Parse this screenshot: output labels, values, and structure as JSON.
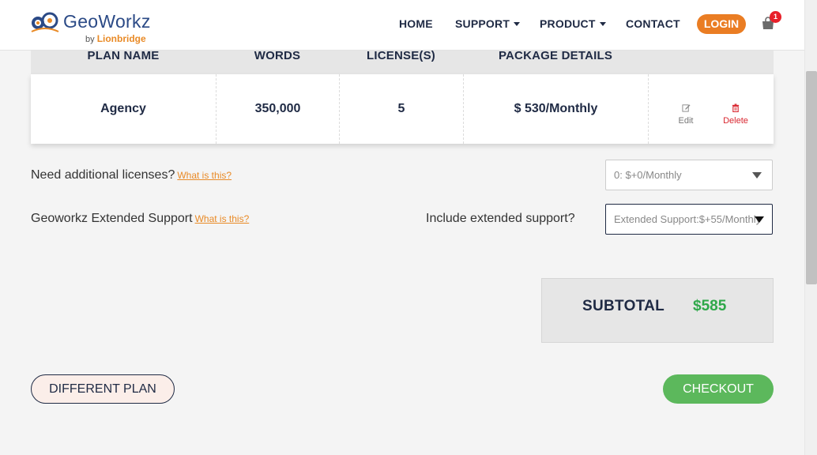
{
  "header": {
    "logo": {
      "name": "GeoWorkz",
      "by": "by",
      "brand": "Lionbridge"
    },
    "nav": [
      {
        "label": "HOME"
      },
      {
        "label": "SUPPORT"
      },
      {
        "label": "PRODUCT"
      },
      {
        "label": "CONTACT"
      }
    ],
    "login_label": "LOGIN",
    "cart_count": "1",
    "icons": {
      "cart": "cart-icon",
      "caret": "caret-down-icon"
    }
  },
  "table": {
    "headers": [
      "PLAN NAME",
      "WORDS",
      "LICENSE(S)",
      "PACKAGE DETAILS"
    ],
    "row": {
      "plan_name": "Agency",
      "words": "350,000",
      "licenses": "5",
      "package": "$ 530/Monthly",
      "edit_label": "Edit",
      "delete_label": "Delete"
    }
  },
  "options": {
    "licenses_question": "Need additional licenses?",
    "licenses_link": "What is this?",
    "licenses_select_value": "0: $+0/Monthly",
    "support_label": "Geoworkz Extended Support",
    "support_link": "What is this?",
    "support_question": "Include extended support?",
    "support_select_value": "Extended Support:$+55/Monthly"
  },
  "subtotal": {
    "label": "SUBTOTAL",
    "value": "$585"
  },
  "buttons": {
    "different_plan": "DIFFERENT PLAN",
    "checkout": "CHECKOUT"
  },
  "colors": {
    "accent_orange": "#ea7d23",
    "navy": "#1f2a44",
    "green": "#5cb85c",
    "subtotal_green": "#2fa84a",
    "delete_red": "#d9262f"
  }
}
